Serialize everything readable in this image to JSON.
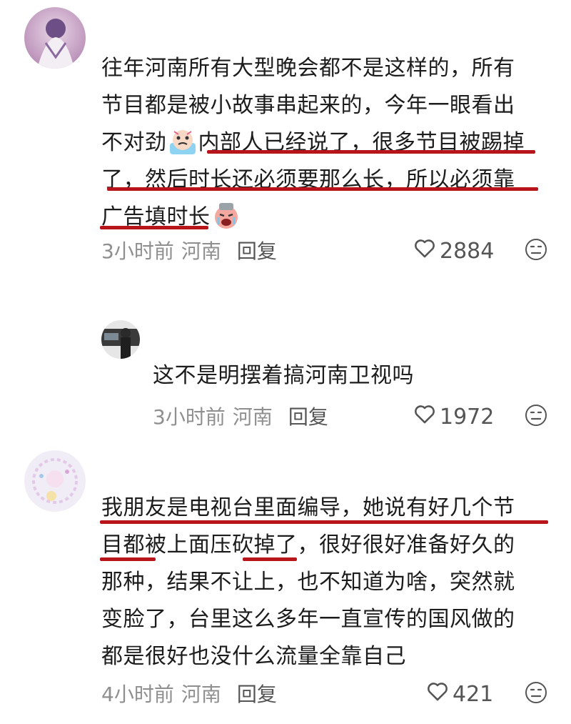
{
  "comments": [
    {
      "lines": [
        "往年河南所有大型晚会都不是这样的，所有",
        "节目都是被小故事串起来的，今年一眼看出",
        "不对劲",
        "内部人已经说了，很多节目被踢掉",
        "了，然后时长还必须要那么长，所以必须靠",
        "广告填时长"
      ],
      "time": "3小时前",
      "location": "河南",
      "reply": "回复",
      "likes": "2884",
      "emoji_icons": [
        "crying-emoji-icon",
        "crying-emoji-icon"
      ]
    },
    {
      "lines": [
        "这不是明摆着搞河南卫视吗"
      ],
      "time": "3小时前",
      "location": "河南",
      "reply": "回复",
      "likes": "1972"
    },
    {
      "lines": [
        "我朋友是电视台里面编导，她说有好几个节",
        "目都被上面压砍掉了，很好很好准备好久的",
        "那种，结果不让上，也不知道为啥，突然就",
        "变脸了，台里这么多年一直宣传的国风做的",
        "都是很好也没什么流量全靠自己"
      ],
      "time": "4小时前",
      "location": "河南",
      "reply": "回复",
      "likes": "421"
    }
  ],
  "colors": {
    "underline": "#b8141b",
    "meta": "#8f8f8f",
    "text": "#1c1c1c"
  },
  "icons": {
    "like": "heart-outline-icon",
    "react": "neutral-face-icon"
  }
}
